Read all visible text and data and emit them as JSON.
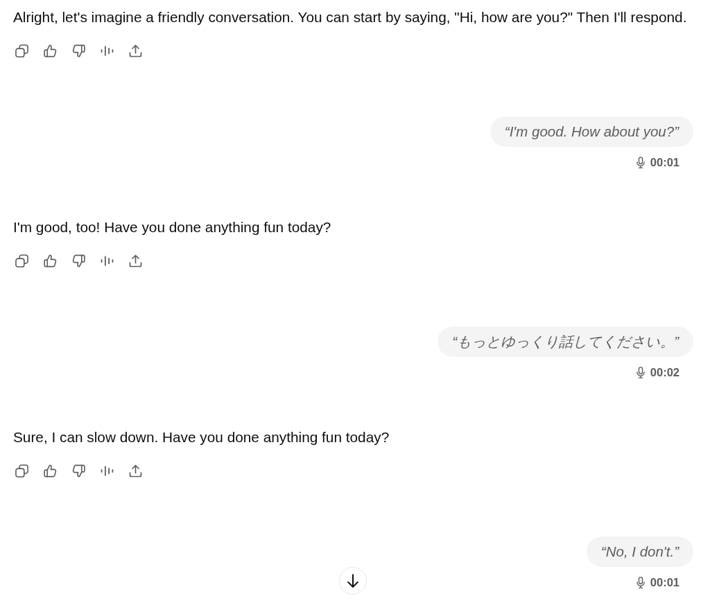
{
  "messages": [
    {
      "kind": "assistant",
      "text": "Alright, let's imagine a friendly conversation. You can start by saying, \"Hi, how are you?\" Then I'll respond."
    },
    {
      "kind": "user",
      "text": "“I'm good. How about you?”",
      "duration": "00:01"
    },
    {
      "kind": "assistant",
      "text": "I'm good, too! Have you done anything fun today?"
    },
    {
      "kind": "user",
      "text": "“もっとゆっくり話してください。”",
      "duration": "00:02"
    },
    {
      "kind": "assistant",
      "text": "Sure, I can slow down. Have you done anything fun today?"
    },
    {
      "kind": "user",
      "text": "“No, I don't.”",
      "duration": "00:01"
    }
  ]
}
